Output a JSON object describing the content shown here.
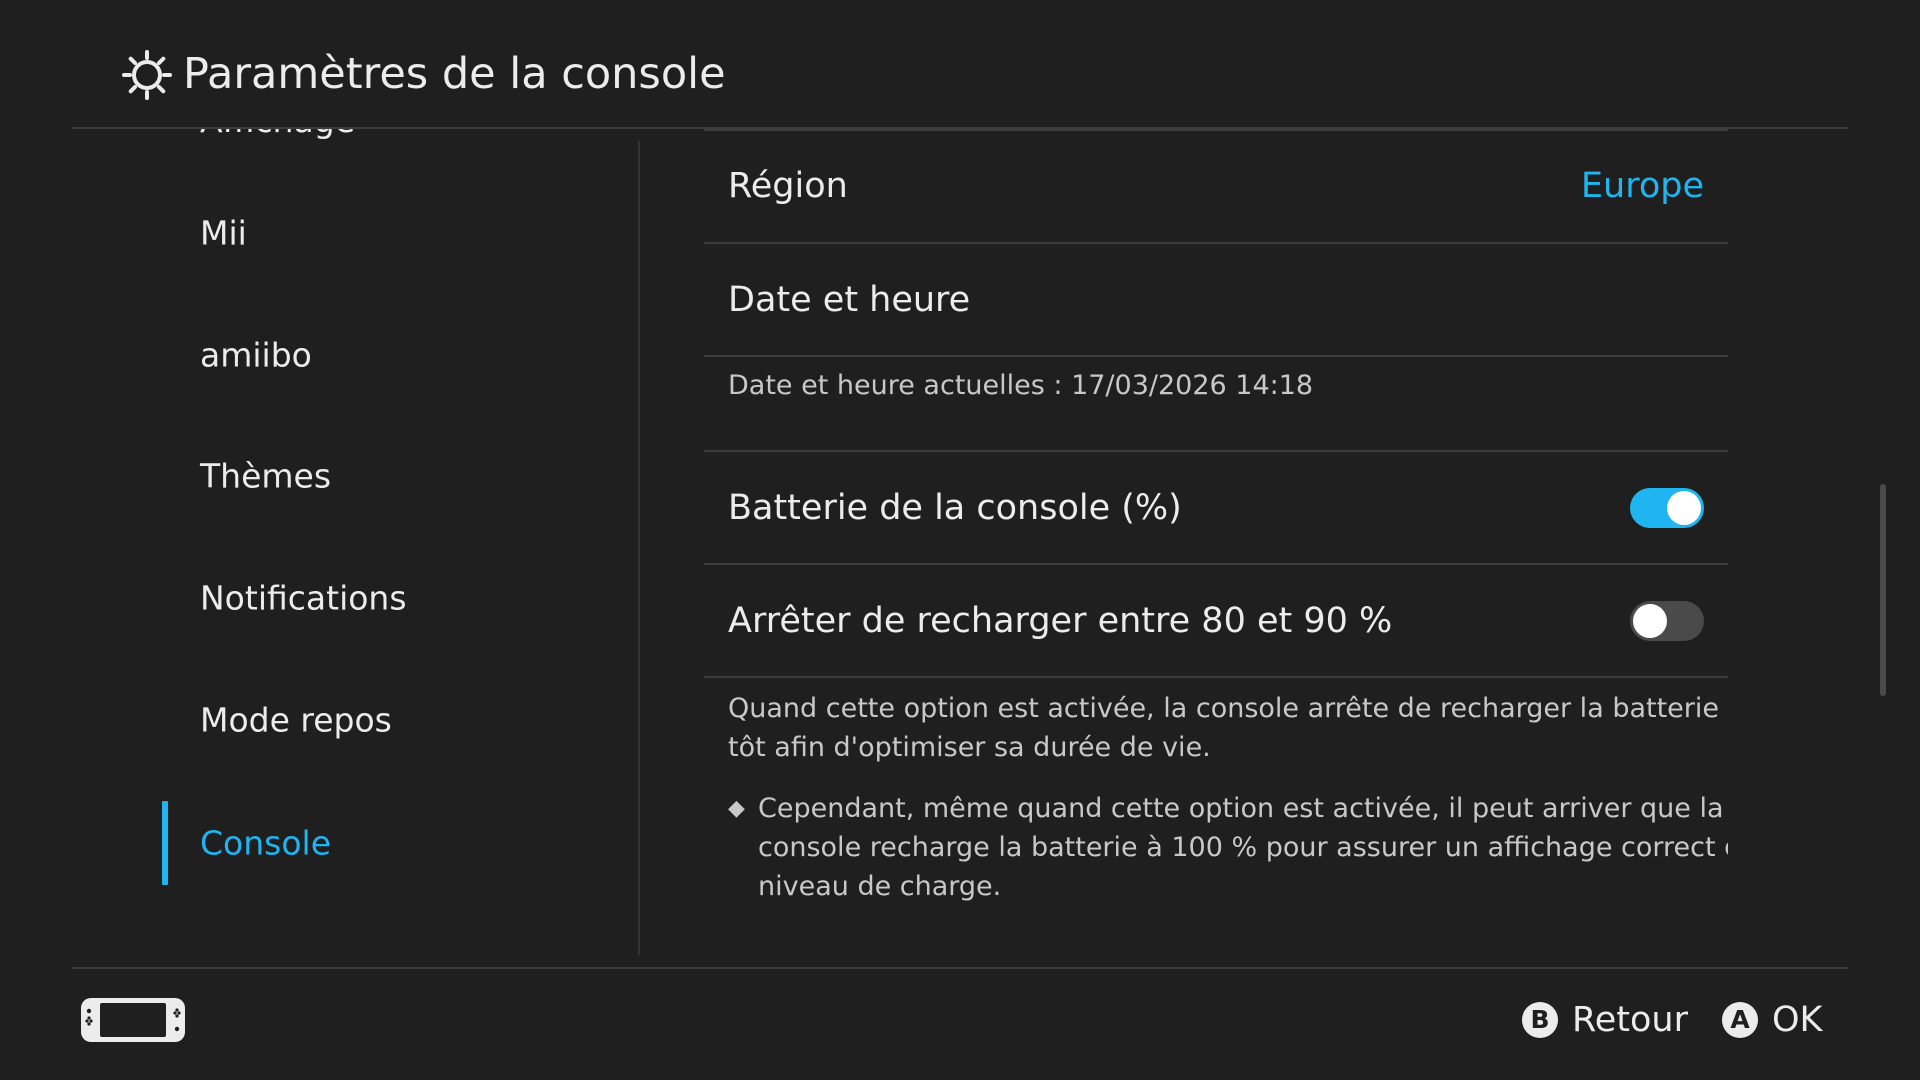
{
  "header": {
    "title": "Paramètres de la console",
    "icon": "gear-icon"
  },
  "sidebar": {
    "clipped_item": "Affichage",
    "items": [
      {
        "label": "Mii",
        "active": false
      },
      {
        "label": "amiibo",
        "active": false
      },
      {
        "label": "Thèmes",
        "active": false
      },
      {
        "label": "Notifications",
        "active": false
      },
      {
        "label": "Mode repos",
        "active": false
      },
      {
        "label": "Console",
        "active": true
      }
    ]
  },
  "content": {
    "region": {
      "label": "Région",
      "value": "Europe"
    },
    "datetime": {
      "label": "Date et heure",
      "current": "Date et heure actuelles : 17/03/2026 14:18"
    },
    "battery_percent": {
      "label": "Batterie de la console (%)",
      "enabled": true
    },
    "stop_charging": {
      "label": "Arrêter de recharger entre 80 et 90 %",
      "enabled": false
    },
    "stop_charging_description": {
      "line1": "Quand cette option est activée, la console arrête de recharger la batterie plus",
      "line2": "tôt afin d'optimiser sa durée de vie."
    },
    "stop_charging_note": {
      "bullet": "◆",
      "line1": "Cependant, même quand cette option est activée, il peut arriver que la",
      "line2": "console recharge la batterie à 100 % pour assurer un affichage correct du",
      "line3": "niveau de charge."
    }
  },
  "footer": {
    "console_icon": "handheld-console-icon",
    "back": {
      "button": "B",
      "label": "Retour"
    },
    "ok": {
      "button": "A",
      "label": "OK"
    }
  },
  "colors": {
    "background": "#1f1f1f",
    "accent": "#1fb5f0",
    "text": "#ececec",
    "secondary_text": "#c8c8c8",
    "divider": "#3d3d3d"
  }
}
